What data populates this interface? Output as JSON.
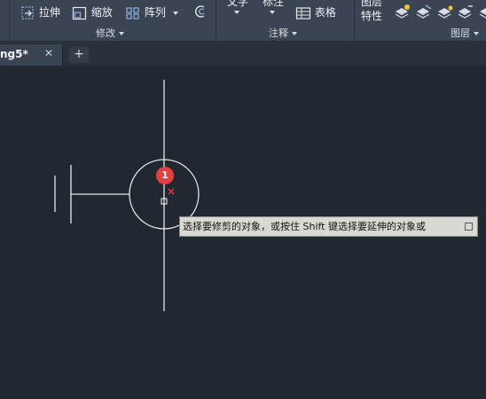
{
  "ribbon": {
    "modify_panel": {
      "title": "修改",
      "stretch_label": "拉伸",
      "scale_label": "缩放",
      "array_label": "阵列"
    },
    "annotate_panel": {
      "title": "注释",
      "text_label": "文字",
      "dimension_label": "标注",
      "table_label": "表格"
    },
    "layers_panel": {
      "title": "图层",
      "layer_label": "图层",
      "properties_label": "特性"
    }
  },
  "tabs": {
    "active_label": "ng5*",
    "close_glyph": "✕",
    "add_glyph": "+"
  },
  "canvas": {
    "tooltip_text": "选择要修剪的对象，或按住 Shift 键选择要延伸的对象或",
    "step_badge": "1"
  }
}
